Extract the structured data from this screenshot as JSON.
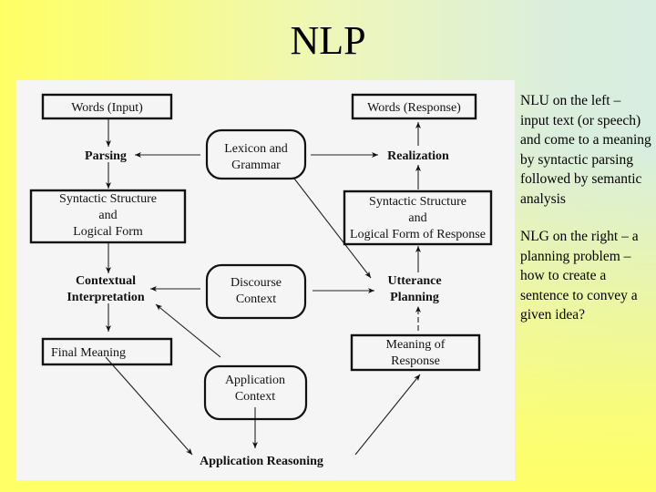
{
  "slide": {
    "title": "NLP"
  },
  "diagram": {
    "nodes": {
      "words_input": "Words (Input)",
      "parsing": "Parsing",
      "lexicon_grammar": [
        "Lexicon and",
        "Grammar"
      ],
      "syntactic_structure": [
        "Syntactic Structure",
        "and",
        "Logical Form"
      ],
      "contextual_interpretation": [
        "Contextual",
        "Interpretation"
      ],
      "discourse_context": [
        "Discourse",
        "Context"
      ],
      "final_meaning": "Final Meaning",
      "application_context": [
        "Application",
        "Context"
      ],
      "application_reasoning": "Application Reasoning",
      "words_response": "Words (Response)",
      "realization": "Realization",
      "syntactic_structure_response": [
        "Syntactic Structure",
        "and",
        "Logical Form of Response"
      ],
      "utterance_planning": [
        "Utterance",
        "Planning"
      ],
      "meaning_of_response": [
        "Meaning of",
        "Response"
      ]
    }
  },
  "notes": {
    "nlu": "NLU on the left – input text (or speech) and come to a meaning by syntactic parsing followed by semantic analysis",
    "nlg": "NLG on the right – a planning problem – how to create a sentence to convey a given idea?"
  }
}
